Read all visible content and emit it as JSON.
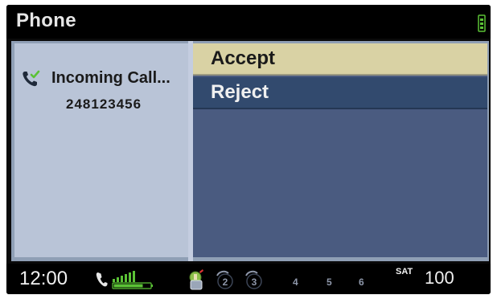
{
  "window": {
    "title": "Phone"
  },
  "call": {
    "status": "Incoming Call...",
    "number": "248123456"
  },
  "menu": {
    "accept": "Accept",
    "reject": "Reject"
  },
  "status_bar": {
    "time": "12:00",
    "presets": [
      "4",
      "5",
      "6"
    ],
    "source": "SAT",
    "channel": "100"
  },
  "icons": {
    "title_bar": "phone-battery-icon",
    "call": "incoming-call-icon",
    "signal": "phone-signal-icon",
    "source": "radio-source-icon",
    "preset_2": "preset-2-icon",
    "preset_3": "preset-3-icon"
  },
  "colors": {
    "left_panel": "#b9c4d7",
    "right_panel": "#4a5b80",
    "selected_item": "#d9d2a4",
    "unselected_item": "#324a6e",
    "accent_green": "#5bc236"
  }
}
